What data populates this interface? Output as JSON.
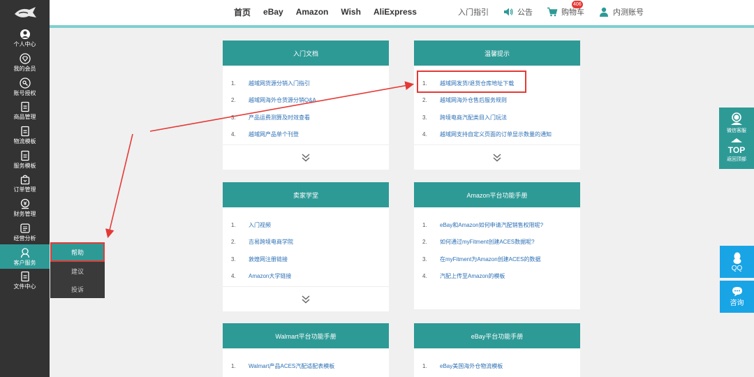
{
  "sidebar": {
    "items": [
      {
        "label": "个人中心",
        "icon": "user-icon"
      },
      {
        "label": "我的会员",
        "icon": "diamond-icon"
      },
      {
        "label": "账号授权",
        "icon": "key-icon"
      },
      {
        "label": "商品管理",
        "icon": "document-icon"
      },
      {
        "label": "物流模板",
        "icon": "document-icon"
      },
      {
        "label": "服务模板",
        "icon": "document-icon"
      },
      {
        "label": "订单管理",
        "icon": "bag-icon"
      },
      {
        "label": "财务管理",
        "icon": "money-icon"
      },
      {
        "label": "经营分析",
        "icon": "chart-icon"
      },
      {
        "label": "客户服务",
        "icon": "support-icon"
      },
      {
        "label": "文件中心",
        "icon": "file-icon"
      }
    ],
    "submenu": [
      "帮助",
      "建议",
      "投诉"
    ]
  },
  "nav": {
    "home": "首页",
    "ebay": "eBay",
    "amazon": "Amazon",
    "wish": "Wish",
    "aliexpress": "AliExpress",
    "guide": "入门指引",
    "notice": "公告",
    "cart": "购物车",
    "cart_count": "406",
    "account": "内测账号"
  },
  "cards": [
    {
      "title": "入门文档",
      "items": [
        "越域网货源分销入门指引",
        "越域网海外仓货源分销Q&A",
        "产品运费测算及时效查看",
        "越域网产品单个刊登"
      ]
    },
    {
      "title": "温馨提示",
      "items": [
        "越域网发货/退货仓库地址下载",
        "越域网海外仓售后服务规则",
        "跨境电商汽配类目入门玩法",
        "越域网支持自定义页面的订单显示数量的通知"
      ]
    },
    {
      "title": "卖家学堂",
      "items": [
        "入门视频",
        "吉易跨境电商学院",
        "敦煌网注册链接",
        "Amazon大学链接"
      ]
    },
    {
      "title": "Amazon平台功能手册",
      "items": [
        "eBay和Amazon如何申请汽配销售权限呢?",
        "如何通过myFitment创建ACES数据呢?",
        "在myFitment为Amazon创建ACES的数据",
        "汽配上传至Amazon的模板"
      ]
    },
    {
      "title": "Walmart平台功能手册",
      "items": [
        "Walmart产品ACES汽配适配表模板"
      ]
    },
    {
      "title": "eBay平台功能手册",
      "items": [
        "eBay美国海外仓物流模板"
      ]
    }
  ],
  "float": {
    "kefu": "微信客服",
    "top": "TOP",
    "back_top": "返回顶部",
    "qq": "QQ",
    "ask": "咨询"
  },
  "colors": {
    "teal": "#2e9a96",
    "sidebar": "#333333",
    "link": "#2b6fb5",
    "highlight": "#e53935",
    "blue_float": "#19a4e6"
  }
}
